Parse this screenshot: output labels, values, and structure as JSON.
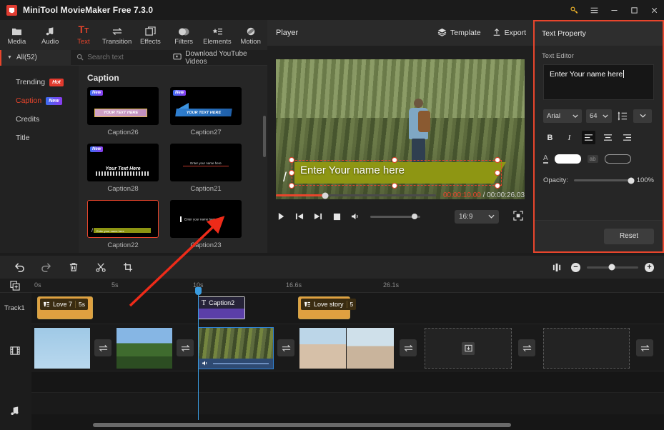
{
  "window": {
    "app_title": "MiniTool MovieMaker Free 7.3.0",
    "logo_letter": "M",
    "controls": {
      "key": "key-icon",
      "menu": "menu-icon",
      "minimize": "minimize-icon",
      "maximize": "maximize-icon",
      "close": "close-icon"
    }
  },
  "topnav": {
    "items": [
      {
        "label": "Media",
        "icon": "folder-icon"
      },
      {
        "label": "Audio",
        "icon": "music-note-icon"
      },
      {
        "label": "Text",
        "icon": "text-tt-icon"
      },
      {
        "label": "Transition",
        "icon": "transition-arrows-icon"
      },
      {
        "label": "Effects",
        "icon": "effects-squares-icon"
      },
      {
        "label": "Filters",
        "icon": "filters-circles-icon"
      },
      {
        "label": "Elements",
        "icon": "elements-star-list-icon"
      },
      {
        "label": "Motion",
        "icon": "motion-sphere-icon"
      }
    ],
    "active_index": 2
  },
  "filterbar": {
    "all_label": "All(52)",
    "search_placeholder": "Search text",
    "search_value": "",
    "download_label": "Download YouTube Videos"
  },
  "categories": [
    {
      "label": "Trending",
      "badge": "Hot",
      "badge_type": "hot",
      "active": false
    },
    {
      "label": "Caption",
      "badge": "New",
      "badge_type": "new",
      "active": true
    },
    {
      "label": "Credits",
      "badge": "",
      "badge_type": "",
      "active": false
    },
    {
      "label": "Title",
      "badge": "",
      "badge_type": "",
      "active": false
    }
  ],
  "grid": {
    "title": "Caption",
    "items": [
      {
        "label": "Caption26",
        "badge": "New",
        "preview_text": "YOUR TEXT HERE",
        "style": "yellow-bar",
        "selected": false
      },
      {
        "label": "Caption27",
        "badge": "New",
        "preview_text": "YOUR TEXT HERE",
        "style": "blue-flag",
        "selected": false
      },
      {
        "label": "Caption28",
        "badge": "New",
        "preview_text": "Your Text Here",
        "style": "script-squiggle",
        "selected": false
      },
      {
        "label": "Caption21",
        "badge": "",
        "preview_text": "Enter your name here",
        "style": "red-underline",
        "selected": false
      },
      {
        "label": "Caption22",
        "badge": "",
        "preview_text": "Enter your name here",
        "style": "olive-bar",
        "selected": true
      },
      {
        "label": "Caption23",
        "badge": "",
        "preview_text": "Enter your name here",
        "style": "left-bar",
        "selected": false
      }
    ]
  },
  "player": {
    "title": "Player",
    "template_label": "Template",
    "export_label": "Export",
    "overlay_text": "Enter Your name here",
    "current_time": "00:00:10.00",
    "separator": " / ",
    "total_time": "00:00:26.03",
    "aspect_ratio": "16:9",
    "progress_percent": 31,
    "volume_percent": 88
  },
  "text_property": {
    "panel_title": "Text Property",
    "section_label": "Text Editor",
    "editor_value": "Enter Your name here",
    "font_family": "Arial",
    "font_size": "64",
    "line_height_icon": "line-height-icon",
    "more_icon": "chevron-down-icon",
    "format": {
      "bold": "B",
      "italic": "I",
      "align_left": "align-left-icon",
      "align_center": "align-center-icon",
      "align_right": "align-right-icon",
      "active_align": "left"
    },
    "color": {
      "text_color_label": "A",
      "text_color": "#ffffff",
      "outline_label": "ab",
      "outline_color": "#00000000"
    },
    "opacity_label": "Opacity:",
    "opacity_value": "100%",
    "reset_label": "Reset"
  },
  "timeline_toolbar": {
    "icons": [
      "undo-icon",
      "redo-icon",
      "delete-icon",
      "split-icon",
      "crop-icon"
    ],
    "right_icons": [
      "audio-detach-icon",
      "zoom-out-icon",
      "zoom-in-icon"
    ],
    "zoom_percent": 48
  },
  "timeline": {
    "ruler_ticks": [
      "0s",
      "5s",
      "10s",
      "16.6s",
      "26.1s"
    ],
    "add_track_icon": "add-media-icon",
    "tracks": [
      {
        "name": "Track1",
        "type": "text"
      },
      {
        "name": "",
        "type": "video",
        "icon": "film-icon"
      },
      {
        "name": "",
        "type": "audio",
        "icon": "music-note-icon"
      }
    ],
    "text_clips": [
      {
        "name": "Love 7",
        "duration": "5s",
        "type": "text",
        "icon": "text-clip-icon"
      },
      {
        "name": "Caption2",
        "duration": "",
        "type": "caption",
        "icon": "T"
      },
      {
        "name": "Love story",
        "duration": "5",
        "type": "text",
        "icon": "text-clip-icon"
      }
    ],
    "video_clips": [
      {
        "style": "v1",
        "has_audio": false
      },
      {
        "style": "v2",
        "has_audio": false
      },
      {
        "style": "v3",
        "has_audio": true,
        "selected": true
      },
      {
        "style": "v4",
        "has_audio": false
      },
      {
        "style": "v5",
        "has_audio": false
      }
    ],
    "empty_slots": 2,
    "transition_icon": "transition-arrows-icon",
    "empty_slot_icon": "import-icon",
    "playhead_time": "10s"
  },
  "annotation": {
    "arrow_color": "#ee2b19"
  }
}
